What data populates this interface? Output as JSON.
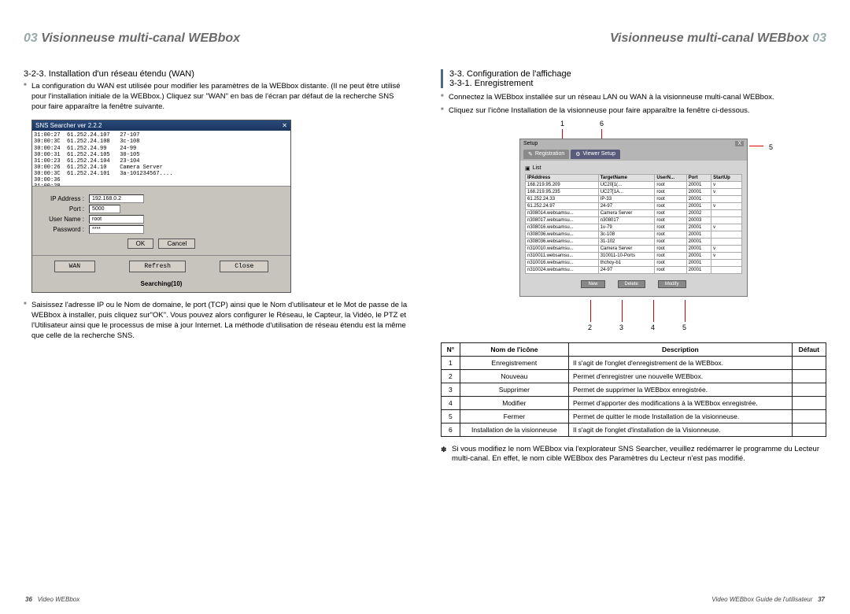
{
  "left": {
    "chapter_num": "03",
    "chapter_title": "Visionneuse multi-canal WEBbox",
    "subsection_title": "3-2-3. Installation d'un réseau étendu (WAN)",
    "para1": "La configuration du WAN est utilisée pour modifier les paramètres de la WEBbox distante. (Il ne peut être utilisé pour l'installation initiale de la WEBbox.) Cliquez sur \"WAN\" en bas de l'écran par défaut de la recherche SNS pour faire apparaître la fenêtre suivante.",
    "para2": "Saisissez l'adresse IP ou le Nom de domaine, le port (TCP) ainsi que le Nom d'utilisateur et le Mot de passe de la WEBbox à installer, puis cliquez sur\"OK\". Vous pouvez alors configurer le Réseau, le Capteur, la Vidéo, le PTZ et l'Utilisateur ainsi que le processus de mise à jour Internet. La méthode d'utilisation de réseau étendu est la même que celle de la recherche SNS.",
    "sns": {
      "title": "SNS Searcher ver 2.2.2",
      "rows_text": "31:00:27  61.252.24.107   27-107\n30:00:3C  61.252.24.108   3c-108\n30:00:24  61.252.24.99    24-99\n30:00:31  61.252.24.105   30-105\n31:00:23  61.252.24.104   23-104\n30:00:26  61.252.24.10    Camera Server\n30:00:3C  61.252.24.101   3a-101234567....\n30:00:36  \n31:00:28  ",
      "ip_label": "IP Address :",
      "ip_value": "192.168.0.2",
      "port_label": "Port :",
      "port_value": "5000",
      "user_label": "User Name :",
      "user_value": "root",
      "pass_label": "Password :",
      "pass_value": "****",
      "ok": "OK",
      "cancel": "Cancel",
      "wan": "WAN",
      "refresh": "Refresh",
      "close": "Close",
      "status": "Searching(10)"
    },
    "footer_page": "36",
    "footer_text": "Video WEBbox"
  },
  "right": {
    "chapter_title": "Visionneuse multi-canal WEBbox",
    "chapter_num": "03",
    "section_title": "3-3. Configuration de l'affichage",
    "subsection_title": "3-3-1. Enregistrement",
    "para1": "Connectez la WEBbox installée sur un réseau LAN ou WAN à la visionneuse multi-canal WEBbox.",
    "para2": "Cliquez sur l'icône Installation de la visionneuse pour faire apparaître la fenêtre ci-dessous.",
    "callouts": {
      "c1": "1",
      "c2": "2",
      "c3": "3",
      "c4": "4",
      "c5": "5",
      "c6": "6"
    },
    "setup": {
      "title": "Setup",
      "tab_registration": "Registration",
      "tab_viewer_setup": "Viewer Setup",
      "list_label": "List",
      "close_x": "X",
      "headers": [
        "IPAddress",
        "TargetName",
        "UserN...",
        "Port",
        "StartUp"
      ],
      "rows": [
        [
          "168.219.95.209",
          "UC20[1(...",
          "root",
          "20001",
          "v"
        ],
        [
          "168.219.95.235",
          "UC27[1A...",
          "root",
          "20001",
          "v"
        ],
        [
          "61.252.24.33",
          "IP-33",
          "root",
          "20001",
          ""
        ],
        [
          "61.252.24.97",
          "24-97",
          "root",
          "20001",
          "v"
        ],
        [
          "n308014.websamsu...",
          "Camera Server",
          "root",
          "20002",
          ""
        ],
        [
          "n308017.websamsu...",
          "n308017",
          "root",
          "20003",
          ""
        ],
        [
          "n308016.websamsu...",
          "1v-79",
          "root",
          "20001",
          "v"
        ],
        [
          "n308036.websamsu...",
          "3c-108",
          "root",
          "20001",
          ""
        ],
        [
          "n308036.websamsu...",
          "31-102",
          "root",
          "20001",
          ""
        ],
        [
          "n310010.websamsu...",
          "Camera Server",
          "root",
          "20001",
          "v"
        ],
        [
          "n310011.websamsu...",
          "310011-10-Ports",
          "root",
          "20001",
          "v"
        ],
        [
          "n310016.websamsu...",
          "thchoy-b1",
          "root",
          "20001",
          ""
        ],
        [
          "n310024.websamsu...",
          "24-97",
          "root",
          "20001",
          ""
        ]
      ],
      "btn_new": "New",
      "btn_delete": "Delete",
      "btn_modify": "Modify"
    },
    "desc_headers": {
      "n": "N°",
      "name": "Nom de l'icône",
      "desc": "Description",
      "def": "Défaut"
    },
    "desc_rows": [
      {
        "n": "1",
        "name": "Enregistrement",
        "desc": "Il s'agit de l'onglet d'enregistrement de la WEBbox.",
        "def": ""
      },
      {
        "n": "2",
        "name": "Nouveau",
        "desc": "Permet d'enregistrer une nouvelle WEBbox.",
        "def": ""
      },
      {
        "n": "3",
        "name": "Supprimer",
        "desc": "Permet de supprimer la WEBbox enregistrée.",
        "def": ""
      },
      {
        "n": "4",
        "name": "Modifier",
        "desc": "Permet d'apporter des modifications à la WEBbox enregistrée.",
        "def": ""
      },
      {
        "n": "5",
        "name": "Fermer",
        "desc": "Permet de quitter le mode Installation de la visionneuse.",
        "def": ""
      },
      {
        "n": "6",
        "name": "Installation de la visionneuse",
        "desc": "Il s'agit de l'onglet d'installation de la Visionneuse.",
        "def": ""
      }
    ],
    "note": "Si vous modifiez le nom WEBbox via l'explorateur SNS Searcher, veuillez redémarrer le programme du Lecteur multi-canal. En effet, le nom cible WEBbox des Paramètres du Lecteur n'est pas modifié.",
    "footer_text": "Video WEBbox Guide de l'utilisateur",
    "footer_page": "37"
  }
}
